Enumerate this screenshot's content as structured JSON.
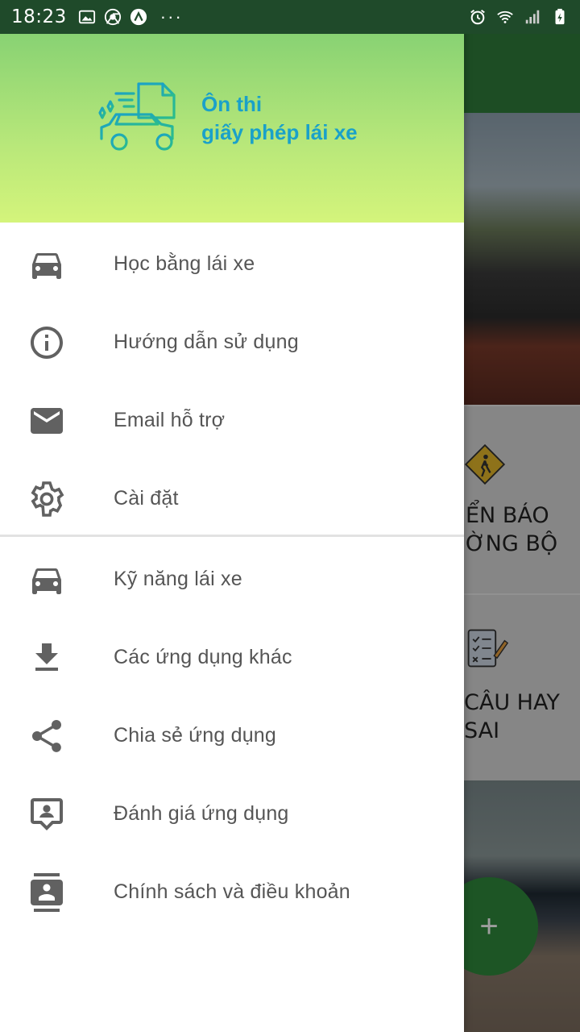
{
  "status_bar": {
    "time": "18:23",
    "more": "···",
    "left_icons": [
      "image-icon",
      "chrome-icon",
      "app-icon"
    ],
    "right_icons": [
      "alarm-icon",
      "wifi-icon",
      "signal-icon",
      "battery-icon"
    ]
  },
  "drawer": {
    "header": {
      "title_line1": "Ôn thi",
      "title_line2": "giấy phép lái xe",
      "logo_icon": "car-document-icon",
      "title_color": "#1aa1c9"
    },
    "section1": [
      {
        "label": "Học bằng lái xe",
        "icon": "car-icon"
      },
      {
        "label": "Hướng dẫn sử dụng",
        "icon": "info-icon"
      },
      {
        "label": "Email hỗ trợ",
        "icon": "email-icon"
      },
      {
        "label": "Cài đặt",
        "icon": "gear-icon"
      }
    ],
    "section2": [
      {
        "label": "Kỹ năng lái xe",
        "icon": "car-icon"
      },
      {
        "label": "Các ứng dụng khác",
        "icon": "download-icon"
      },
      {
        "label": "Chia sẻ ứng dụng",
        "icon": "share-icon"
      },
      {
        "label": "Đánh giá ứng dụng",
        "icon": "rate-review-icon"
      },
      {
        "label": "Chính sách và điều khoản",
        "icon": "contacts-icon"
      }
    ]
  },
  "background": {
    "card1_line1": "ỂN BÁO",
    "card1_line2": "ỜNG BỘ",
    "card2_line1": "CÂU HAY",
    "card2_line2": "SAI",
    "fab_label": "+",
    "accent": "#2f7d3a"
  }
}
